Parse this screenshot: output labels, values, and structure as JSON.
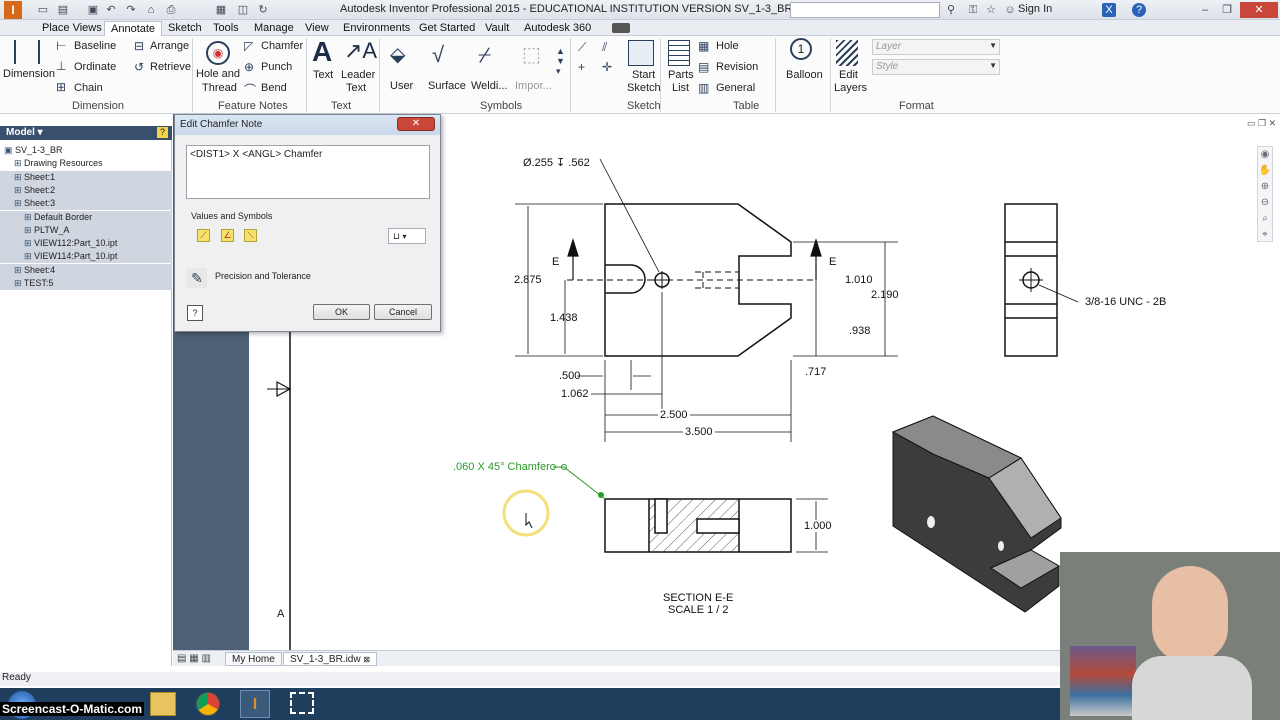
{
  "window": {
    "title": "Autodesk Inventor Professional 2015 - EDUCATIONAL INSTITUTION VERSION   SV_1-3_BR",
    "signin": "Sign In"
  },
  "tabs": [
    "Place Views",
    "Annotate",
    "Sketch",
    "Tools",
    "Manage",
    "View",
    "Environments",
    "Get Started",
    "Vault",
    "Autodesk 360"
  ],
  "ribbon": {
    "dimension": "Dimension",
    "baseline": "Baseline",
    "ordinate": "Ordinate",
    "chain": "Chain",
    "arrange": "Arrange",
    "retrieve": "Retrieve",
    "hole_thread_1": "Hole and",
    "hole_thread_2": "Thread",
    "chamfer": "Chamfer",
    "punch": "Punch",
    "bend": "Bend",
    "text": "Text",
    "leader_text_1": "Leader",
    "leader_text_2": "Text",
    "user": "User",
    "surface": "Surface",
    "welding": "Weldi...",
    "import": "Impor...",
    "start_sketch_1": "Start",
    "start_sketch_2": "Sketch",
    "parts_list_1": "Parts",
    "parts_list_2": "List",
    "hole": "Hole",
    "revision": "Revision",
    "general": "General",
    "balloon": "Balloon",
    "edit_layers_1": "Edit",
    "edit_layers_2": "Layers",
    "layer_placeholder": "Layer",
    "style_placeholder": "Style",
    "groups": {
      "dimension": "Dimension",
      "feature_notes": "Feature Notes",
      "text": "Text",
      "symbols": "Symbols",
      "sketch": "Sketch",
      "table": "Table",
      "format": "Format"
    }
  },
  "panel": {
    "header": "Model",
    "items": [
      {
        "label": "SV_1-3_BR",
        "selected": false
      },
      {
        "label": "Drawing Resources",
        "selected": false
      },
      {
        "label": "Sheet:1",
        "selected": true
      },
      {
        "label": "Sheet:2",
        "selected": true
      },
      {
        "label": "Sheet:3",
        "selected": true
      },
      {
        "label": "Default Border",
        "selected": true
      },
      {
        "label": "PLTW_A",
        "selected": true
      },
      {
        "label": "VIEW112:Part_10.ipt",
        "selected": true
      },
      {
        "label": "VIEW114:Part_10.ipt",
        "selected": true
      },
      {
        "label": "Sheet:4",
        "selected": true
      },
      {
        "label": "TEST:5",
        "selected": true
      }
    ]
  },
  "dialog": {
    "title": "Edit Chamfer Note",
    "text": "<DIST1> X <ANGL> Chamfer",
    "values_label": "Values and Symbols",
    "precision_label": "Precision and Tolerance",
    "ok": "OK",
    "cancel": "Cancel"
  },
  "drawing": {
    "hole_callout": "Ø.255 ↧ .562",
    "section_mark": "E",
    "d_2875": "2.875",
    "d_1438": "1.438",
    "d_1010": "1.010",
    "d_2190": "2.190",
    "d_938": ".938",
    "d_500": ".500",
    "d_1062": "1.062",
    "d_717": ".717",
    "d_2500": "2.500",
    "d_3500": "3.500",
    "thread_note": "3/8-16 UNC - 2B",
    "chamfer_note": ".060 X 45° Chamfer",
    "d_1000": "1.000",
    "section_title": "SECTION E-E",
    "section_scale": "SCALE 1 / 2",
    "zone_letter": "A"
  },
  "sheet_tabs": {
    "home": "My Home",
    "file": "SV_1-3_BR.idw"
  },
  "status": "Ready",
  "taskbar": {
    "brand": "Screencast-O-Matic.com"
  }
}
